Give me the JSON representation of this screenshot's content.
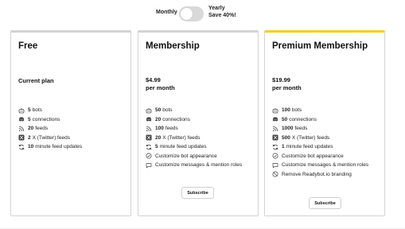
{
  "billing_toggle": {
    "monthly_label": "Monthly",
    "yearly_label": "Yearly",
    "save_label": "Save 40%!",
    "state": "monthly"
  },
  "plans": [
    {
      "name": "Free",
      "subtitle": "Current plan",
      "features": [
        {
          "icon": "bot-icon",
          "bold": "5",
          "text": "bots"
        },
        {
          "icon": "discord-icon",
          "bold": "5",
          "text": "connections"
        },
        {
          "icon": "rss-icon",
          "bold": "20",
          "text": "feeds"
        },
        {
          "icon": "x-twitter-icon",
          "bold": "2",
          "text": "X (Twitter) feeds"
        },
        {
          "icon": "refresh-icon",
          "bold": "10",
          "text": "minute feed updates"
        }
      ]
    },
    {
      "name": "Membership",
      "price": "$4.99",
      "period": "per month",
      "features": [
        {
          "icon": "bot-icon",
          "bold": "50",
          "text": "bots"
        },
        {
          "icon": "discord-icon",
          "bold": "20",
          "text": "connections"
        },
        {
          "icon": "rss-icon",
          "bold": "100",
          "text": "feeds"
        },
        {
          "icon": "x-twitter-icon",
          "bold": "20",
          "text": "X (Twitter) feeds"
        },
        {
          "icon": "refresh-icon",
          "bold": "5",
          "text": "minute feed updates"
        },
        {
          "icon": "check-circle-icon",
          "bold": "",
          "text": "Customize bot appearance"
        },
        {
          "icon": "message-icon",
          "bold": "",
          "text": "Customize messages & mention roles"
        }
      ],
      "subscribe_label": "Subscribe"
    },
    {
      "name": "Premium Membership",
      "price": "$19.99",
      "period": "per month",
      "accent_color": "#f5d020",
      "features": [
        {
          "icon": "bot-icon",
          "bold": "100",
          "text": "bots"
        },
        {
          "icon": "discord-icon",
          "bold": "50",
          "text": "connections"
        },
        {
          "icon": "rss-icon",
          "bold": "1000",
          "text": "feeds"
        },
        {
          "icon": "x-twitter-icon",
          "bold": "500",
          "text": "X (Twitter) feeds"
        },
        {
          "icon": "refresh-icon",
          "bold": "1",
          "text": "minute feed updates"
        },
        {
          "icon": "check-circle-icon",
          "bold": "",
          "text": "Customize bot appearance"
        },
        {
          "icon": "message-icon",
          "bold": "",
          "text": "Customize messages & mention roles"
        },
        {
          "icon": "no-branding-icon",
          "bold": "",
          "text": "Remove Readybot.io branding"
        }
      ],
      "subscribe_label": "Subscribe"
    }
  ]
}
